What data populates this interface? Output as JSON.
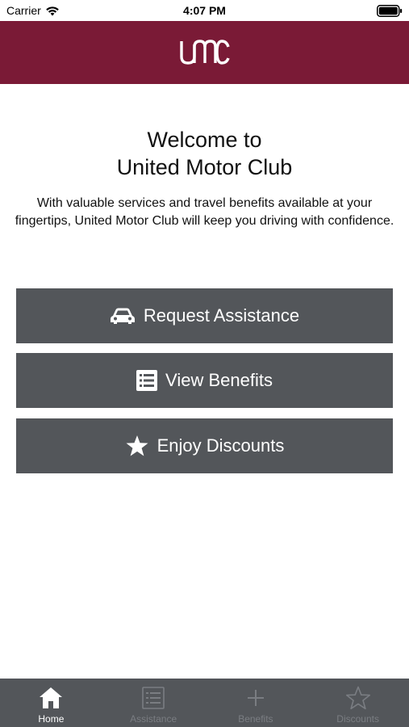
{
  "status_bar": {
    "carrier": "Carrier",
    "time": "4:07 PM"
  },
  "header": {
    "logo_text": "UMC"
  },
  "welcome": {
    "line1": "Welcome to",
    "line2": "United Motor Club"
  },
  "intro": "With valuable services and travel benefits available at your fingertips, United Motor Club will keep you driving with confidence.",
  "actions": [
    {
      "label": "Request Assistance",
      "icon": "car-icon"
    },
    {
      "label": "View Benefits",
      "icon": "list-icon"
    },
    {
      "label": "Enjoy Discounts",
      "icon": "star-icon"
    }
  ],
  "tabs": [
    {
      "label": "Home",
      "icon": "home-icon",
      "active": true
    },
    {
      "label": "Assistance",
      "icon": "list-icon",
      "active": false
    },
    {
      "label": "Benefits",
      "icon": "plus-icon",
      "active": false
    },
    {
      "label": "Discounts",
      "icon": "star-outline-icon",
      "active": false
    }
  ],
  "colors": {
    "header_bg": "#7a1a36",
    "button_bg": "#53565a",
    "tabbar_bg": "#53565a"
  }
}
